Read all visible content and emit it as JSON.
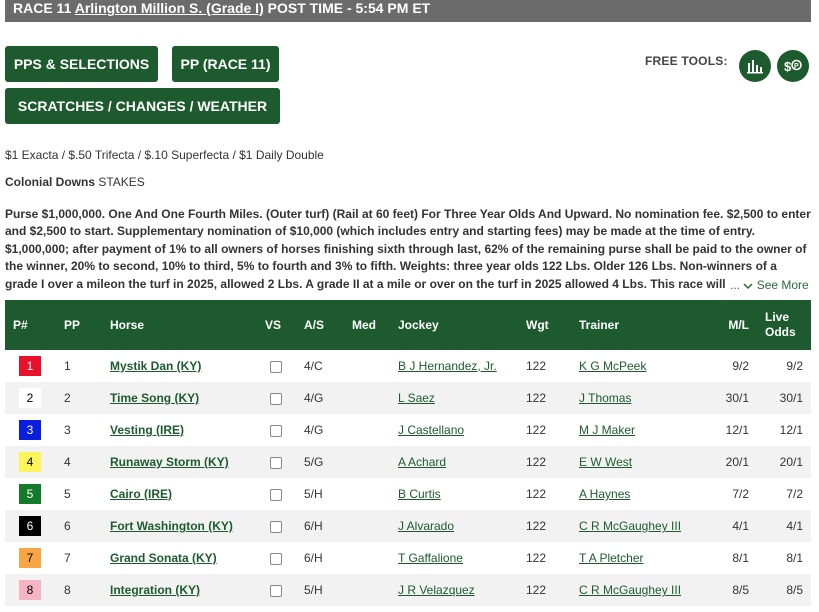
{
  "header": {
    "race_prefix": "RACE 11",
    "race_name": "Arlington Million S. (Grade I)",
    "post_time": "POST TIME - 5:54 PM ET"
  },
  "buttons": {
    "pps": "PPS & SELECTIONS",
    "pp_race": "PP (RACE 11)",
    "scratches": "SCRATCHES / CHANGES / WEATHER"
  },
  "tools": {
    "label": "FREE TOOLS:"
  },
  "wagers": "$1 Exacta / $.50 Trifecta / $.10 Superfecta / $1 Daily Double",
  "track": {
    "name": "Colonial Downs",
    "type": "STAKES"
  },
  "conditions": "Purse $1,000,000. One And One Fourth Miles. (Outer turf) (Rail at 60 feet) For Three Year Olds And Upward. No nomination fee. $2,500 to enter and $2,500 to start. Supplementary nomination of $10,000 (which includes entry and starting fees) may be made at the time of entry. $1,000,000; after payment of 1% to all owners of horses finishing sixth through last, 62% of the remaining purse shall be paid to the owner of the winner, 20% to second, 10% to third, 5% to fourth and 3% to fifth. Weights: three year olds 122 Lbs. Older 126 Lbs. Non-winners of a grade I over a mileon the turf in 2025, allowed 2 Lbs. A grade II at a mile or over on the turf in 2025 allowed 4 Lbs. This race will be",
  "see_more": {
    "dots": "...",
    "label": "See More"
  },
  "table": {
    "headers": {
      "pnum": "P#",
      "pp": "PP",
      "horse": "Horse",
      "vs": "VS",
      "as": "A/S",
      "med": "Med",
      "jockey": "Jockey",
      "wgt": "Wgt",
      "trainer": "Trainer",
      "ml": "M/L",
      "live1": "Live",
      "live2": "Odds"
    },
    "rows": [
      {
        "pnum": "1",
        "pp": "1",
        "horse": "Mystik Dan (KY)",
        "as": "4/C",
        "med": "",
        "jockey": "B J Hernandez, Jr.",
        "wgt": "122",
        "trainer": "K G McPeek",
        "ml": "9/2",
        "live": "9/2",
        "bg": "#e8102a",
        "fg": "#ffffff"
      },
      {
        "pnum": "2",
        "pp": "2",
        "horse": "Time Song (KY)",
        "as": "4/G",
        "med": "",
        "jockey": "L Saez",
        "wgt": "122",
        "trainer": "J Thomas",
        "ml": "30/1",
        "live": "30/1",
        "bg": "#ffffff",
        "fg": "#000000"
      },
      {
        "pnum": "3",
        "pp": "3",
        "horse": "Vesting (IRE)",
        "as": "4/G",
        "med": "",
        "jockey": "J Castellano",
        "wgt": "122",
        "trainer": "M J Maker",
        "ml": "12/1",
        "live": "12/1",
        "bg": "#0a1ee0",
        "fg": "#ffffff"
      },
      {
        "pnum": "4",
        "pp": "4",
        "horse": "Runaway Storm (KY)",
        "as": "5/G",
        "med": "",
        "jockey": "A Achard",
        "wgt": "122",
        "trainer": "E W West",
        "ml": "20/1",
        "live": "20/1",
        "bg": "#fbf55a",
        "fg": "#000000"
      },
      {
        "pnum": "5",
        "pp": "5",
        "horse": "Cairo (IRE)",
        "as": "5/H",
        "med": "",
        "jockey": "B Curtis",
        "wgt": "122",
        "trainer": "A Haynes",
        "ml": "7/2",
        "live": "7/2",
        "bg": "#137a2b",
        "fg": "#ffffff"
      },
      {
        "pnum": "6",
        "pp": "6",
        "horse": "Fort Washington (KY)",
        "as": "6/H",
        "med": "",
        "jockey": "J Alvarado",
        "wgt": "122",
        "trainer": "C R McGaughey III",
        "ml": "4/1",
        "live": "4/1",
        "bg": "#000000",
        "fg": "#ffffff"
      },
      {
        "pnum": "7",
        "pp": "7",
        "horse": "Grand Sonata (KY)",
        "as": "6/H",
        "med": "",
        "jockey": "T Gaffalione",
        "wgt": "122",
        "trainer": "T A Pletcher",
        "ml": "8/1",
        "live": "8/1",
        "bg": "#f7a545",
        "fg": "#000000"
      },
      {
        "pnum": "8",
        "pp": "8",
        "horse": "Integration (KY)",
        "as": "5/H",
        "med": "",
        "jockey": "J R Velazquez",
        "wgt": "122",
        "trainer": "C R McGaughey III",
        "ml": "8/5",
        "live": "8/5",
        "bg": "#f7b3c2",
        "fg": "#000000"
      }
    ]
  },
  "colors": {
    "brand_green": "#1d5b2e",
    "header_gray": "#6b6b6b",
    "row_alt": "#f2f2f2"
  },
  "icons": {
    "tool1": "bar-chart-icon",
    "tool2": "dollar-tag-icon",
    "see_more": "chevron-down-icon"
  }
}
